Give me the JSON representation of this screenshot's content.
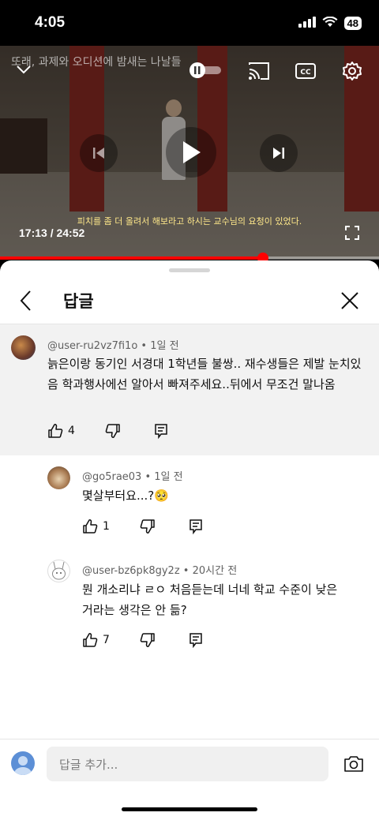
{
  "status_bar": {
    "time": "4:05",
    "battery": "48"
  },
  "video": {
    "title_overlay": "또래, 과제와 오디션에 밤새는 나날들",
    "subtitle": "피치를 좀 더 올려서 해보라고 하시는 교수님의 요청이 있었다.",
    "time_display": "17:13 / 24:52",
    "progress": 0.693
  },
  "sheet": {
    "title": "답글",
    "parent_comment": {
      "author": "@user-ru2vz7fi1o",
      "time": "1일 전",
      "text": "늙은이랑 동기인 서경대 1학년들 불쌍.. 재수생들은 제발 눈치있음 학과행사에선 알아서 빠져주세요..뒤에서 무조건 말나옴",
      "likes": "4"
    },
    "replies": [
      {
        "author": "@go5rae03",
        "time": "1일 전",
        "text": "몇살부터요...?🥺",
        "likes": "1"
      },
      {
        "author": "@user-bz6pk8gy2z",
        "time": "20시간 전",
        "text": "뭔 개소리냐 ㄹㅇ 처음듣는데 너네 학교 수준이 낮은 거라는 생각은 안 듦?",
        "likes": "7"
      }
    ],
    "composer": {
      "placeholder": "답글 추가..."
    }
  },
  "colors": {
    "accent": "#ff0000",
    "parent_bg": "#f2f2f2"
  }
}
